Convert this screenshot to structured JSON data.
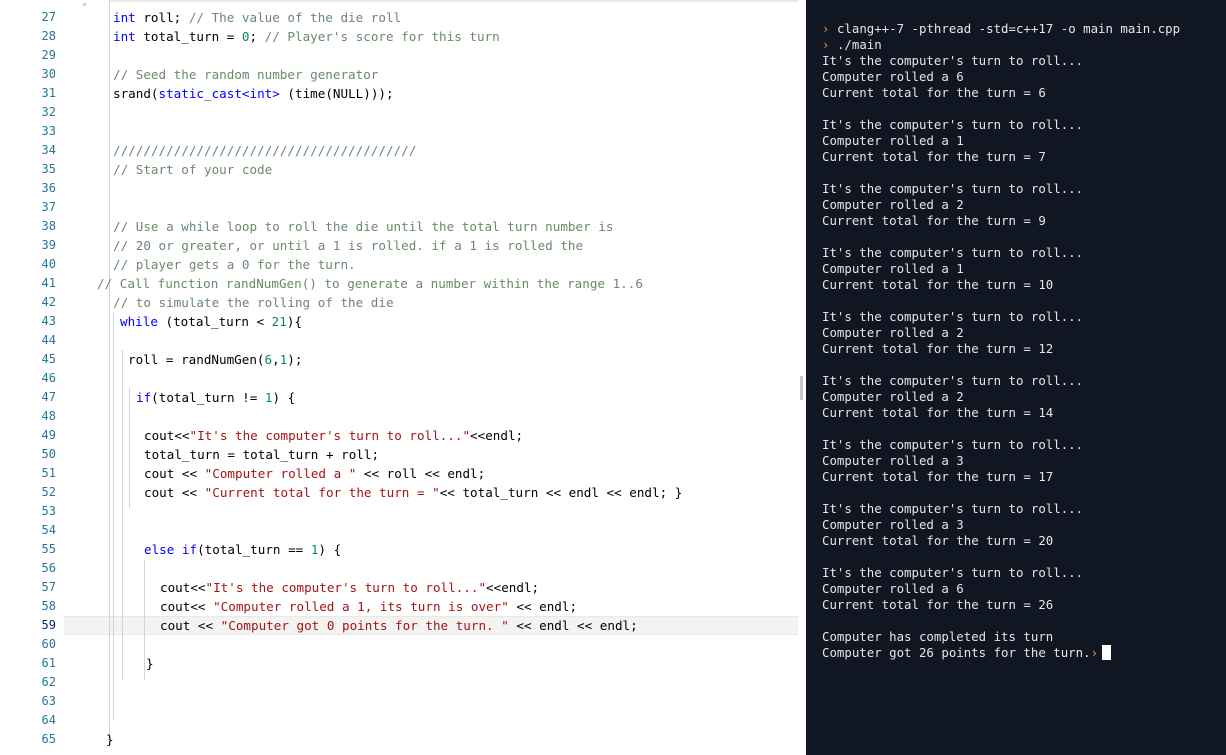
{
  "editor": {
    "line_numbers": [
      "27",
      "28",
      "29",
      "30",
      "31",
      "32",
      "33",
      "34",
      "35",
      "36",
      "37",
      "38",
      "39",
      "40",
      "41",
      "42",
      "43",
      "44",
      "45",
      "46",
      "47",
      "48",
      "49",
      "50",
      "51",
      "52",
      "53",
      "54",
      "55",
      "56",
      "57",
      "58",
      "59",
      "60",
      "61",
      "62",
      "63",
      "64",
      "65"
    ],
    "code": {
      "l27": {
        "a": "int",
        "b": " roll; ",
        "c": "// The value of the die roll"
      },
      "l28": {
        "a": "int",
        "b": " total_turn = ",
        "n": "0",
        "d": "; ",
        "c": "// Player's score for this turn"
      },
      "l30": {
        "c": "// Seed the random number generator"
      },
      "l31": {
        "a": "srand(",
        "s": "static_cast<int>",
        "b": " (time(NULL)));"
      },
      "l34": {
        "c": "////////////////////////////////////////"
      },
      "l35": {
        "c": "// Start of your code"
      },
      "l38": {
        "c": "// Use a while loop to roll the die until the total turn number is"
      },
      "l39": {
        "c": "// 20 or greater, or until a 1 is rolled. if a 1 is rolled the"
      },
      "l40": {
        "c": "// player gets a 0 for the turn."
      },
      "l41": {
        "c": "// Call function randNumGen() to generate a number within the range 1..6"
      },
      "l42": {
        "c": "// to simulate the rolling of the die"
      },
      "l43": {
        "k": "while",
        "b": " (total_turn < ",
        "n": "21",
        "d": "){"
      },
      "l45": {
        "a": "roll = randNumGen(",
        "n": "6",
        "b": ",",
        "n2": "1",
        "d": ");"
      },
      "l47": {
        "k": "if",
        "b": "(total_turn != ",
        "n": "1",
        "d": ") {"
      },
      "l49": {
        "a": "cout<<",
        "s": "\"It's the computer's turn to roll...\"",
        "b": "<<endl;"
      },
      "l50": {
        "a": "total_turn = total_turn + roll;"
      },
      "l51": {
        "a": "cout << ",
        "s": "\"Computer rolled a \"",
        "b": " << roll << endl;"
      },
      "l52": {
        "a": "cout << ",
        "s": "\"Current total for the turn = \"",
        "b": "<< total_turn << endl << endl; }"
      },
      "l55": {
        "k": "else if",
        "b": "(total_turn == ",
        "n": "1",
        "d": ") {"
      },
      "l57": {
        "a": "cout<<",
        "s": "\"It's the computer's turn to roll...\"",
        "b": "<<endl;"
      },
      "l58": {
        "a": "cout<< ",
        "s": "\"Computer rolled a 1, its turn is over\"",
        "b": " << endl;"
      },
      "l59": {
        "a": "cout << ",
        "s": "\"Computer got 0 points for the turn. \"",
        "b": " << endl << endl;"
      },
      "l61": {
        "a": "}"
      },
      "l65": {
        "a": "}"
      }
    }
  },
  "console": {
    "prompt_symbol": "›",
    "cmd1": "clang++-7 -pthread -std=c++17 -o main main.cpp",
    "cmd2": "./main",
    "turns": [
      {
        "header": "It's the computer's turn to roll...",
        "rolled": "Computer rolled a 6",
        "total": "Current total for the turn = 6"
      },
      {
        "header": "It's the computer's turn to roll...",
        "rolled": "Computer rolled a 1",
        "total": "Current total for the turn = 7"
      },
      {
        "header": "It's the computer's turn to roll...",
        "rolled": "Computer rolled a 2",
        "total": "Current total for the turn = 9"
      },
      {
        "header": "It's the computer's turn to roll...",
        "rolled": "Computer rolled a 1",
        "total": "Current total for the turn = 10"
      },
      {
        "header": "It's the computer's turn to roll...",
        "rolled": "Computer rolled a 2",
        "total": "Current total for the turn = 12"
      },
      {
        "header": "It's the computer's turn to roll...",
        "rolled": "Computer rolled a 2",
        "total": "Current total for the turn = 14"
      },
      {
        "header": "It's the computer's turn to roll...",
        "rolled": "Computer rolled a 3",
        "total": "Current total for the turn = 17"
      },
      {
        "header": "It's the computer's turn to roll...",
        "rolled": "Computer rolled a 3",
        "total": "Current total for the turn = 20"
      },
      {
        "header": "It's the computer's turn to roll...",
        "rolled": "Computer rolled a 6",
        "total": "Current total for the turn = 26"
      }
    ],
    "done1": "Computer has completed its turn",
    "done2": "Computer got 26 points for the turn."
  },
  "colors": {
    "console_bg": "#101622",
    "prompt": "#ff8c2e",
    "keyword": "#0000ff",
    "string": "#a31515",
    "comment": "#6a8a6a",
    "number": "#098658",
    "line_number": "#237893"
  }
}
